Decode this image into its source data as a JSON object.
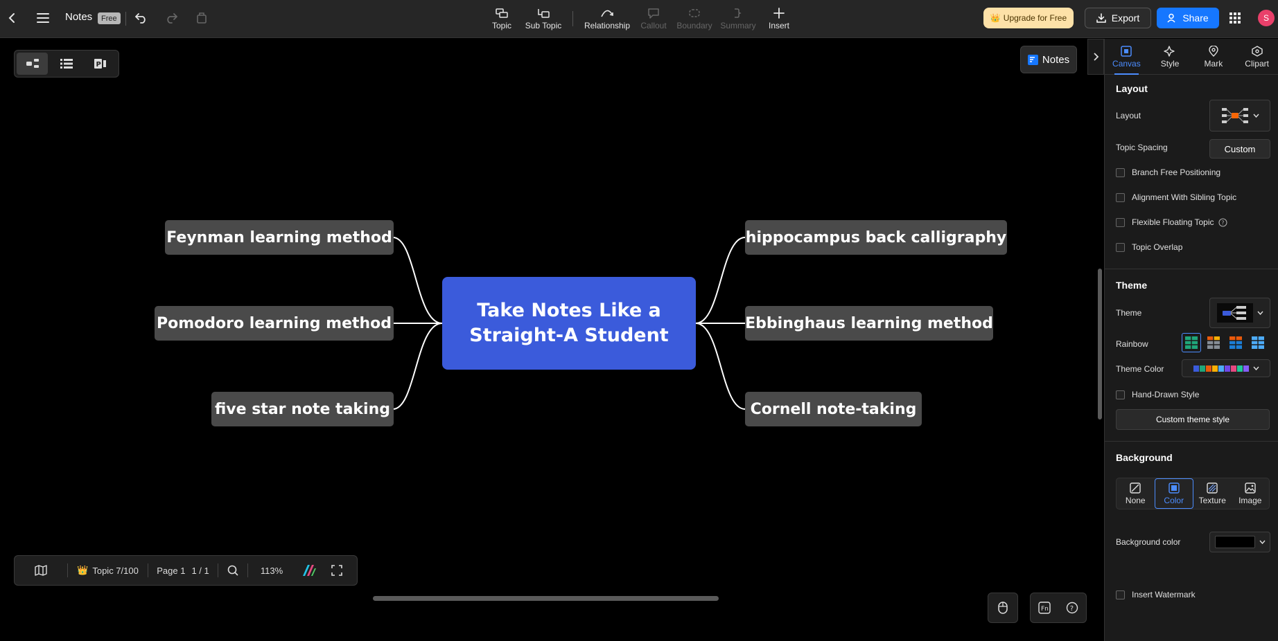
{
  "app": {
    "title": "Notes",
    "plan_badge": "Free"
  },
  "toolbar": {
    "tools": [
      {
        "label": "Topic",
        "enabled": true
      },
      {
        "label": "Sub Topic",
        "enabled": true
      },
      {
        "label": "Relationship",
        "enabled": true
      },
      {
        "label": "Callout",
        "enabled": false
      },
      {
        "label": "Boundary",
        "enabled": false
      },
      {
        "label": "Summary",
        "enabled": false
      },
      {
        "label": "Insert",
        "enabled": true
      }
    ],
    "upgrade_label": "Upgrade for Free",
    "export_label": "Export",
    "share_label": "Share",
    "avatar_initial": "S"
  },
  "canvas": {
    "notes_button": "Notes",
    "central_topic": {
      "line1": "Take Notes Like a",
      "line2": "Straight-A Student"
    },
    "topics_left": [
      "Feynman learning method",
      "Pomodoro learning method",
      "five star note taking"
    ],
    "topics_right": [
      "hippocampus back calligraphy",
      "Ebbinghaus learning method",
      "Cornell note-taking"
    ],
    "colors": {
      "central": "#3b5bdb",
      "topic": "#4a4a4a",
      "background": "#000000",
      "accent": "#1677ff"
    }
  },
  "statusbar": {
    "topic_count": "Topic 7/100",
    "page_label": "Page 1",
    "page_count": "1 / 1",
    "zoom": "113%"
  },
  "panel": {
    "tabs": [
      "Canvas",
      "Style",
      "Mark",
      "Clipart"
    ],
    "layout": {
      "section": "Layout",
      "layout_label": "Layout",
      "spacing_label": "Topic Spacing",
      "spacing_value": "Custom",
      "checks": [
        "Branch Free Positioning",
        "Alignment With Sibling Topic",
        "Flexible Floating Topic",
        "Topic Overlap"
      ]
    },
    "theme": {
      "section": "Theme",
      "theme_label": "Theme",
      "rainbow_label": "Rainbow",
      "color_label": "Theme Color",
      "hand_drawn": "Hand-Drawn Style",
      "custom_button": "Custom theme style",
      "palette": [
        "#3b5bdb",
        "#1fa67a",
        "#e8590c",
        "#fab005",
        "#4dabf7",
        "#7048e8",
        "#e64980",
        "#20c997",
        "#845ef7"
      ]
    },
    "background": {
      "section": "Background",
      "options": [
        "None",
        "Color",
        "Texture",
        "Image"
      ],
      "color_label": "Background color",
      "watermark": "Insert Watermark"
    }
  }
}
